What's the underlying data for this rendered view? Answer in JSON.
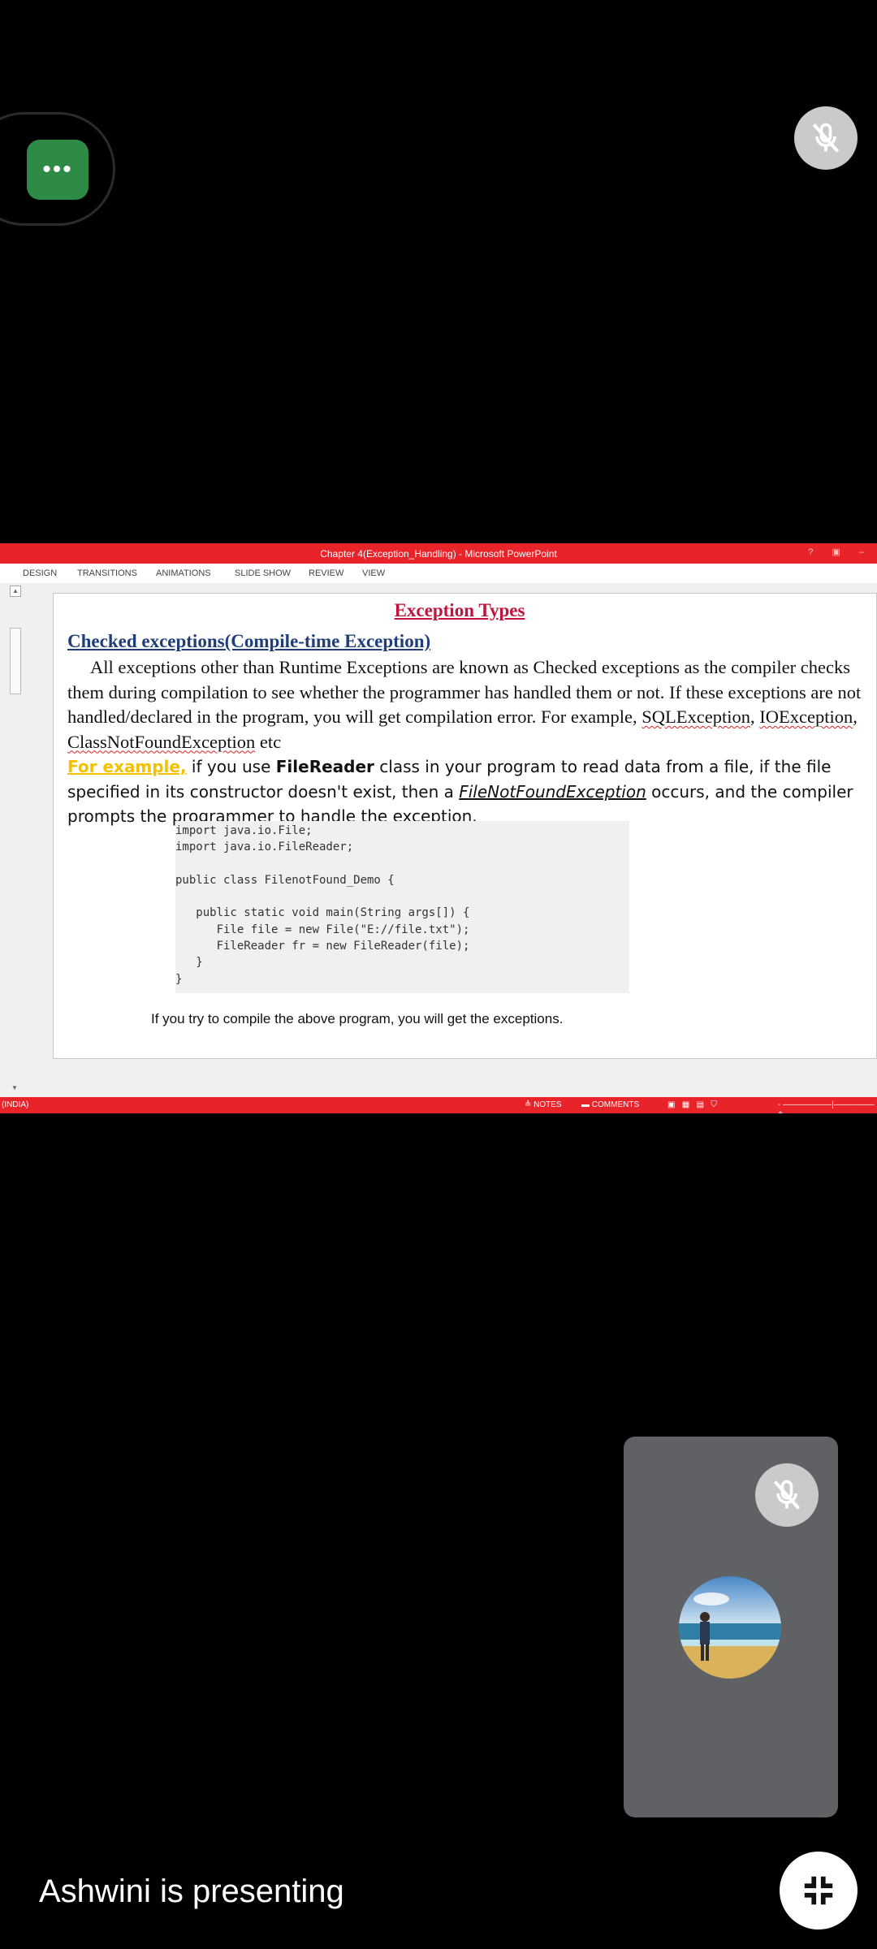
{
  "call": {
    "more_options_label": "•••",
    "presenting_text": "Ashwini is presenting"
  },
  "window": {
    "title": "Chapter 4(Exception_Handling) -  Microsoft PowerPoint",
    "controls": "? ▣ –"
  },
  "ribbon": {
    "tabs": [
      "DESIGN",
      "TRANSITIONS",
      "ANIMATIONS",
      "SLIDE SHOW",
      "REVIEW",
      "VIEW"
    ]
  },
  "slide": {
    "title": "Exception Types",
    "heading": "Checked exceptions(Compile-time Exception)",
    "para1_text": "All exceptions other than Runtime Exceptions are known as Checked exceptions as the compiler checks them during compilation to see whether the programmer has handled them or not. If these exceptions are not handled/declared in the program, you will get compilation error. For example, ",
    "para1_examples": [
      "SQLException",
      "IOException",
      "ClassNotFoundException"
    ],
    "para1_sep": ", ",
    "para1_end": " etc",
    "para2_highlight": "For example,",
    "para2_a": " if you use ",
    "para2_bold": "FileReader",
    "para2_b": " class in your program to read data from a file, if the file specified in its constructor doesn't exist, then a ",
    "para2_italic": "FileNotFoundException",
    "para2_c": " occurs, and the compiler prompts the programmer to handle the exception.",
    "code_lines": [
      "import java.io.File;",
      "import java.io.FileReader;",
      "",
      "public class FilenotFound_Demo {",
      "",
      "   public static void main(String args[]) {",
      "      File file = new File(\"E://file.txt\");",
      "      FileReader fr = new FileReader(file);",
      "   }",
      "}"
    ],
    "caption": "If you try to compile the above program, you will get the  exceptions."
  },
  "statusbar": {
    "language": "(INDIA)",
    "notes": "≜ NOTES",
    "comments": "▬ COMMENTS",
    "zoom": "-  ——————|—————  +"
  },
  "colors": {
    "accent_red": "#e8232a",
    "more_green": "#2e8b46",
    "tile_gray": "#5f6164"
  }
}
